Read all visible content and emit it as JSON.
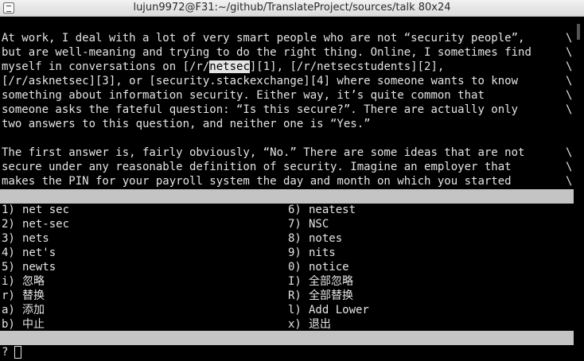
{
  "window": {
    "title": "lujun9972@F31:~/github/TranslateProject/sources/talk 80x24"
  },
  "text_lines": [
    {
      "pre": "At work, I deal with a lot of very smart people who are not “security people”,",
      "hl": "",
      "post": "",
      "wrap": "\\"
    },
    {
      "pre": "but are well-meaning and trying to do the right thing. Online, I sometimes find",
      "hl": "",
      "post": "",
      "wrap": "\\"
    },
    {
      "pre": "myself in conversations on [/r/",
      "hl": "netsec",
      "post": "][1], [/r/netsecstudents][2],",
      "wrap": "\\"
    },
    {
      "pre": "[/r/asknetsec][3], or [security.stackexchange][4] where someone wants to know",
      "hl": "",
      "post": "",
      "wrap": "\\"
    },
    {
      "pre": "something about information security. Either way, it’s quite common that",
      "hl": "",
      "post": "",
      "wrap": "\\"
    },
    {
      "pre": "someone asks the fateful question: “Is this secure?”. There are actually only",
      "hl": "",
      "post": "",
      "wrap": "\\"
    },
    {
      "pre": "two answers to this question, and neither one is “Yes.”",
      "hl": "",
      "post": "",
      "wrap": ""
    },
    {
      "pre": "",
      "hl": "",
      "post": "",
      "wrap": ""
    },
    {
      "pre": "The first answer is, fairly obviously, “No.” There are some ideas that are not",
      "hl": "",
      "post": "",
      "wrap": "\\"
    },
    {
      "pre": "secure under any reasonable definition of security. Imagine an employer that",
      "hl": "",
      "post": "",
      "wrap": "\\"
    },
    {
      "pre": "makes the PIN for your payroll system the day and month on which you started",
      "hl": "",
      "post": "",
      "wrap": "\\"
    }
  ],
  "options_left": [
    {
      "key": "1)",
      "label": "net sec"
    },
    {
      "key": "2)",
      "label": "net-sec"
    },
    {
      "key": "3)",
      "label": "nets"
    },
    {
      "key": "4)",
      "label": "net's"
    },
    {
      "key": "5)",
      "label": "newts"
    },
    {
      "key": "i)",
      "label": "忽略"
    },
    {
      "key": "r)",
      "label": "替换"
    },
    {
      "key": "a)",
      "label": "添加"
    },
    {
      "key": "b)",
      "label": "中止"
    }
  ],
  "options_right": [
    {
      "key": "6)",
      "label": "neatest"
    },
    {
      "key": "7)",
      "label": "NSC"
    },
    {
      "key": "8)",
      "label": "notes"
    },
    {
      "key": "9)",
      "label": "nits"
    },
    {
      "key": "0)",
      "label": "notice"
    },
    {
      "key": "I)",
      "label": "全部忽略"
    },
    {
      "key": "R)",
      "label": "全部替换"
    },
    {
      "key": "l)",
      "label": "Add Lower"
    },
    {
      "key": "x)",
      "label": "退出"
    }
  ],
  "prompt": {
    "symbol": "?"
  },
  "icons": {
    "window_menu": "window-menu-icon"
  }
}
